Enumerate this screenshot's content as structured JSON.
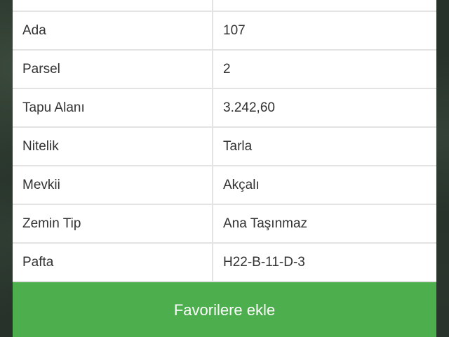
{
  "parcel_table": {
    "rows": [
      {
        "label": "",
        "value": ""
      },
      {
        "label": "Ada",
        "value": "107"
      },
      {
        "label": "Parsel",
        "value": "2"
      },
      {
        "label": "Tapu Alanı",
        "value": "3.242,60"
      },
      {
        "label": "Nitelik",
        "value": "Tarla"
      },
      {
        "label": "Mevkii",
        "value": "Akçalı"
      },
      {
        "label": "Zemin Tip",
        "value": "Ana Taşınmaz"
      },
      {
        "label": "Pafta",
        "value": "H22-B-11-D-3"
      }
    ]
  },
  "actions": {
    "favorite_label": "Favorilere ekle",
    "favorite_color": "#4cae4c"
  },
  "colors": {
    "panel_bg": "#ffffff",
    "divider": "#e3e3e3",
    "text": "#333333"
  }
}
